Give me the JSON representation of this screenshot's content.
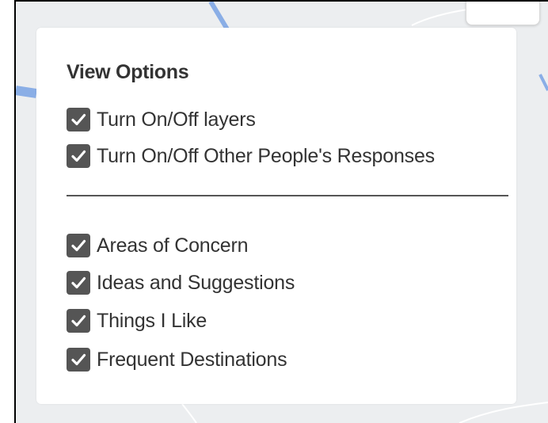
{
  "panel": {
    "title": "View Options",
    "top_options": [
      {
        "label": "Turn On/Off layers",
        "checked": true
      },
      {
        "label": "Turn On/Off Other People's Responses",
        "checked": true
      }
    ],
    "layer_options": [
      {
        "label": "Areas of Concern",
        "checked": true
      },
      {
        "label": "Ideas and Suggestions",
        "checked": true
      },
      {
        "label": "Things I Like",
        "checked": true
      },
      {
        "label": "Frequent Destinations",
        "checked": true
      }
    ]
  },
  "colors": {
    "checkbox_fill": "#555555",
    "map_background": "#eceef0",
    "map_road": "#8aaee6",
    "panel_background": "#ffffff",
    "text": "#333333"
  },
  "icons": {
    "checkbox_checked": "checkmark-icon"
  }
}
